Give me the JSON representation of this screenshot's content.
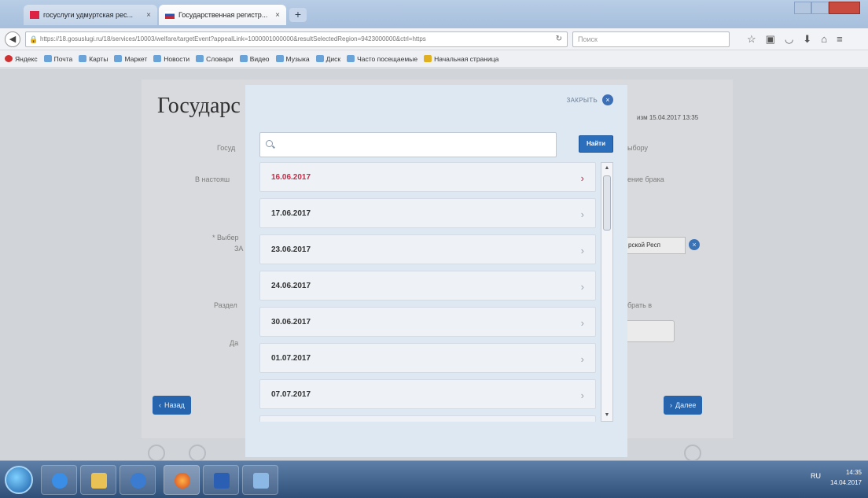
{
  "browser": {
    "tabs": [
      {
        "label": "госуслуги удмуртская рес...",
        "active": false
      },
      {
        "label": "Государственная регистр...",
        "active": true
      }
    ],
    "new_tab": "+",
    "url": "https://18.gosuslugi.ru/18/services/10003/welfare/targetEvent?appealLink=1000001000000&resultSelectedRegion=9423000000&ctrl=https",
    "search_placeholder": "Поиск",
    "bookmarks": [
      "Яндекс",
      "Почта",
      "Карты",
      "Маркет",
      "Новости",
      "Словари",
      "Видео",
      "Музыка",
      "Диск",
      "Часто посещаемые",
      "Начальная страница"
    ]
  },
  "page": {
    "title": "Государс",
    "updated": "изм 15.04.2017 13:35",
    "left_labels": [
      "Госуд",
      "В настояш",
      "* Выбер",
      "ЗА",
      "Раздел",
      "Да"
    ],
    "right_labels": [
      "ыбору",
      "ение брака",
      "рской Респ",
      "брать в"
    ],
    "back_button": "Назад",
    "next_button": "Далее"
  },
  "modal": {
    "close_label": "ЗАКРЫТЬ",
    "search_placeholder": "",
    "search_button": "Найти",
    "dates": [
      "16.06.2017",
      "17.06.2017",
      "23.06.2017",
      "24.06.2017",
      "30.06.2017",
      "01.07.2017",
      "07.07.2017"
    ],
    "selected_index": 0
  },
  "taskbar": {
    "tray_lang": "RU",
    "time": "14:35",
    "date": "14.04.2017"
  },
  "colors": {
    "accent": "#2a6ebc",
    "selected_date": "#c0304a"
  }
}
